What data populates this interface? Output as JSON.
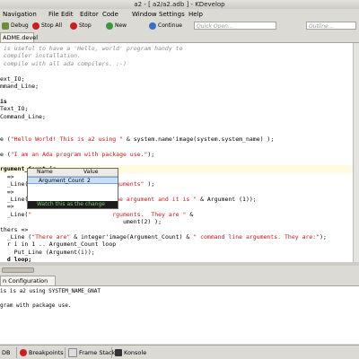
{
  "window": {
    "title": "a2 - [ a2/a2.adb ] - KDevelop"
  },
  "menubar": [
    "Navigation",
    "File",
    "Edit",
    "Editor",
    "Code",
    "Window",
    "Settings",
    "Help"
  ],
  "toolbar": {
    "debug": "Debug",
    "stop_all": "Stop All",
    "stop": "Stop",
    "new": "New",
    "continue": "Continue",
    "quick_open_placeholder": "Quick Open...",
    "outline_placeholder": "Outline..."
  },
  "editor_tab": "ADME.devel",
  "code": [
    {
      "c": " is useful to have a 'Hello, world' program handy to",
      "t": "cm"
    },
    {
      "c": " compiler installation.",
      "t": "cm"
    },
    {
      "c": " compile with all ada compilers. :-)",
      "t": "cm"
    },
    {
      "c": "",
      "t": ""
    },
    {
      "c": "ext_IO;",
      "t": ""
    },
    {
      "c": "mmand_Line;",
      "t": ""
    },
    {
      "c": "",
      "t": ""
    },
    {
      "c": "is",
      "t": "kw"
    },
    {
      "c": "Text_IO;",
      "t": ""
    },
    {
      "c": "Command_Line;",
      "t": ""
    },
    {
      "c": "",
      "t": ""
    },
    {
      "c": "",
      "t": ""
    },
    {
      "c": "e (\"Hello World! This is a2 using \" & system.name'image(system.system_name) );",
      "t": "mix1"
    },
    {
      "c": "",
      "t": ""
    },
    {
      "c": "e (\"I am an Ada program with package use.\");",
      "t": "mix2"
    },
    {
      "c": "",
      "t": ""
    },
    {
      "c": "rgument_Count is",
      "t": "hl"
    },
    {
      "c": "  =>",
      "t": ""
    },
    {
      "c": "  _Line(\"                       rguments\" );",
      "t": "mix3"
    },
    {
      "c": "  =>",
      "t": ""
    },
    {
      "c": "  _Line(\"                       ine argument and it is \" & Argument (1));",
      "t": "mix4"
    },
    {
      "c": "  =>",
      "t": ""
    },
    {
      "c": "  _Line(\"                       rguments.  They are \" &",
      "t": "mix5"
    },
    {
      "c": "                                   ument(2) );",
      "t": ""
    },
    {
      "c": "thers =>",
      "t": ""
    },
    {
      "c": "  _Line (\"There are\" & integer'image(Argument_Count) & \" command line arguments. They are:\");",
      "t": "mix6"
    },
    {
      "c": "  r i in 1 .. Argument_Count loop",
      "t": "mix7"
    },
    {
      "c": "    Put_Line (Argument(i));",
      "t": ""
    },
    {
      "c": "  d loop;",
      "t": "kw"
    }
  ],
  "popup": {
    "col_name": "Name",
    "col_value": "Value",
    "row_name": "Argument_Count",
    "row_value": "2",
    "footer": "Watch this as the change"
  },
  "panel_tab": "n Configuration",
  "output": [
    "is is a2 using SYSTEM_NAME_GNAT",
    "",
    "gram with package use."
  ],
  "statusbar": [
    "DB",
    "Breakpoints",
    "Frame Stack",
    "Konsole"
  ],
  "colors": {
    "string": "#c4161b",
    "comment": "#888888",
    "selection": "#c7dff8",
    "current_line": "#fefbe0"
  }
}
